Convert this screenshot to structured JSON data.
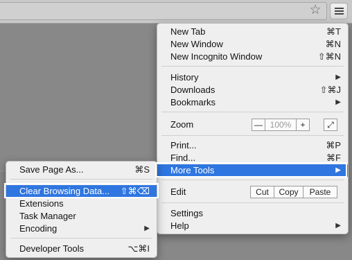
{
  "toolbar": {
    "star_glyph": "☆",
    "menu_icon": "hamburger-icon"
  },
  "main_menu": {
    "new_tab": {
      "label": "New Tab",
      "shortcut": "⌘T"
    },
    "new_window": {
      "label": "New Window",
      "shortcut": "⌘N"
    },
    "new_incognito": {
      "label": "New Incognito Window",
      "shortcut": "⇧⌘N"
    },
    "history": {
      "label": "History",
      "arrow": "▶"
    },
    "downloads": {
      "label": "Downloads",
      "shortcut": "⇧⌘J"
    },
    "bookmarks": {
      "label": "Bookmarks",
      "arrow": "▶"
    },
    "zoom": {
      "label": "Zoom",
      "minus": "—",
      "value": "100%",
      "plus": "+",
      "fullscreen": "⤢"
    },
    "print": {
      "label": "Print...",
      "shortcut": "⌘P"
    },
    "find": {
      "label": "Find...",
      "shortcut": "⌘F"
    },
    "more_tools": {
      "label": "More Tools",
      "arrow": "▶"
    },
    "edit": {
      "label": "Edit",
      "cut": "Cut",
      "copy": "Copy",
      "paste": "Paste"
    },
    "settings": {
      "label": "Settings"
    },
    "help": {
      "label": "Help",
      "arrow": "▶"
    }
  },
  "sub_menu": {
    "save_page": {
      "label": "Save Page As...",
      "shortcut": "⌘S"
    },
    "clear_browsing": {
      "label": "Clear Browsing Data...",
      "shortcut": "⇧⌘⌫"
    },
    "extensions": {
      "label": "Extensions"
    },
    "task_manager": {
      "label": "Task Manager"
    },
    "encoding": {
      "label": "Encoding",
      "arrow": "▶"
    },
    "developer_tools": {
      "label": "Developer Tools",
      "shortcut": "⌥⌘I"
    }
  },
  "colors": {
    "highlight": "#2f76e0",
    "menu_bg": "#efefef",
    "backdrop": "#888888"
  }
}
